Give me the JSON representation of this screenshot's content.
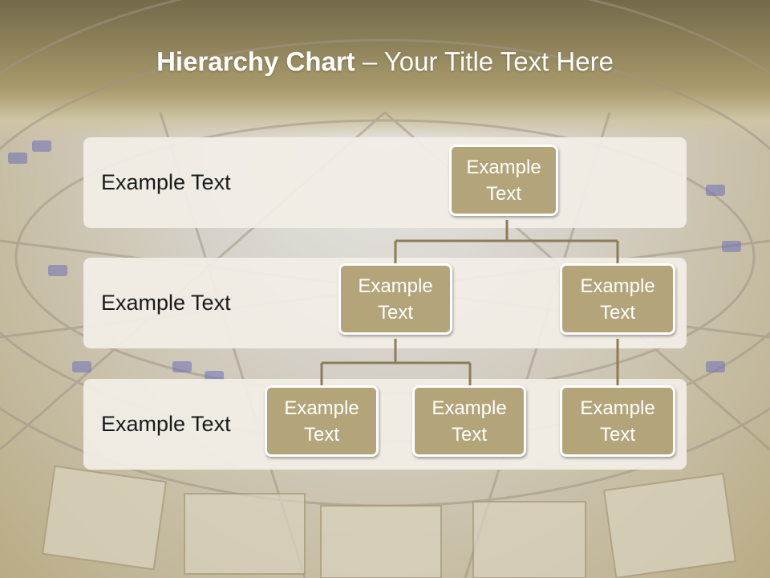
{
  "title": {
    "bold": "Hierarchy Chart",
    "rest": " – Your Title Text Here"
  },
  "bands": [
    {
      "label": "Example Text"
    },
    {
      "label": "Example Text"
    },
    {
      "label": "Example Text"
    }
  ],
  "nodes": {
    "root": "Example Text",
    "level2_left": "Example Text",
    "level2_right": "Example Text",
    "level3_a": "Example Text",
    "level3_b": "Example Text",
    "level3_c": "Example Text"
  },
  "colors": {
    "node_fill": "#b4a479",
    "connector": "#8c7c58",
    "band": "#f2eee6"
  }
}
